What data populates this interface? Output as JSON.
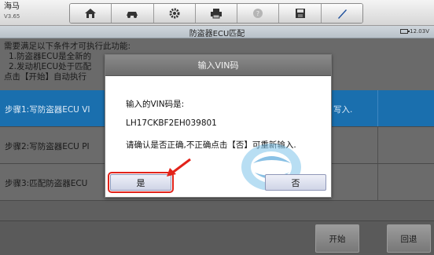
{
  "brand": {
    "name": "海马",
    "version": "V3.65"
  },
  "toolbar": {
    "items": [
      {
        "name": "home-icon"
      },
      {
        "name": "car-icon"
      },
      {
        "name": "gear-icon"
      },
      {
        "name": "printer-icon"
      },
      {
        "name": "help-icon"
      },
      {
        "name": "save-icon"
      },
      {
        "name": "pen-icon"
      }
    ]
  },
  "header": {
    "title": "防盗器ECU匹配",
    "voltage": "12.03V"
  },
  "description": {
    "lines": [
      "需要满足以下条件才可执行此功能:",
      "1.防盗器ECU是全新的",
      "2.发动机ECU处于匹配",
      "点击【开始】自动执行"
    ]
  },
  "steps": [
    {
      "label": "步骤1:写防盗器ECU VI",
      "tail": "写入.",
      "active": true
    },
    {
      "label": "步骤2:写防盗器ECU PI",
      "tail": "",
      "active": false
    },
    {
      "label": "步骤3:匹配防盗器ECU",
      "tail": "",
      "active": false
    }
  ],
  "buttons": {
    "start": "开始",
    "back": "回退"
  },
  "dialog": {
    "title": "输入VIN码",
    "line1": "输入的VIN码是:",
    "vin": "LH17CKBF2EH039801",
    "line3": "请确认是否正确,不正确点击【否】可重新输入.",
    "yes": "是",
    "no": "否"
  },
  "colors": {
    "accent_step": "#1a6fae",
    "highlight": "#e2231a"
  }
}
